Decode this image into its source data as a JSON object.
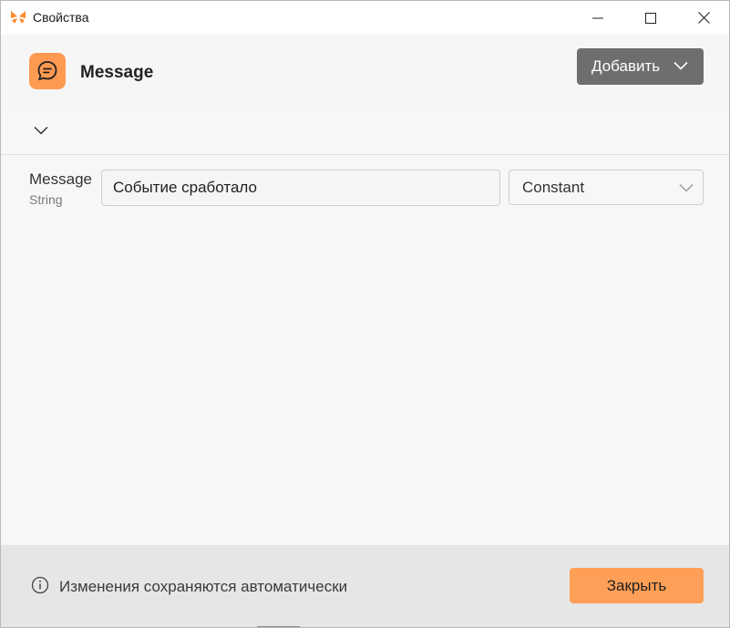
{
  "window": {
    "title": "Свойства"
  },
  "header": {
    "node_title": "Message",
    "add_label": "Добавить",
    "icon": "message-bubble-icon"
  },
  "property": {
    "name": "Message",
    "type": "String",
    "value": "Событие сработало",
    "mode": "Constant"
  },
  "footer": {
    "info_text": "Изменения сохраняются автоматически",
    "close_label": "Закрыть"
  },
  "colors": {
    "accent": "#ff9a52",
    "add_button": "#6e6e6e",
    "footer_bg": "#e6e6e6"
  }
}
